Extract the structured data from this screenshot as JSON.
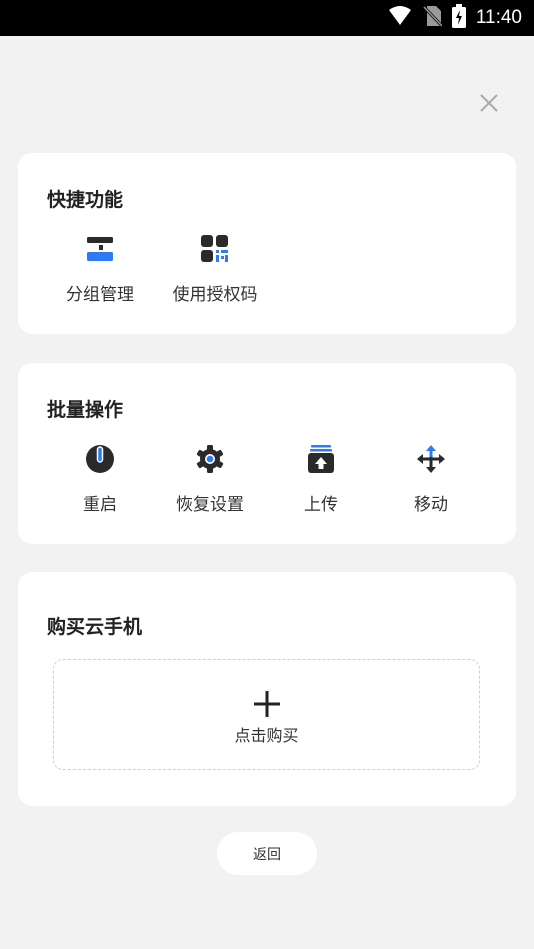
{
  "status_bar": {
    "time": "11:40"
  },
  "quick": {
    "title": "快捷功能",
    "items": [
      {
        "label": "分组管理",
        "icon": "group-manage-icon"
      },
      {
        "label": "使用授权码",
        "icon": "auth-code-icon"
      }
    ]
  },
  "batch": {
    "title": "批量操作",
    "items": [
      {
        "label": "重启",
        "icon": "power-icon"
      },
      {
        "label": "恢复设置",
        "icon": "gear-icon"
      },
      {
        "label": "上传",
        "icon": "upload-icon"
      },
      {
        "label": "移动",
        "icon": "move-icon"
      }
    ]
  },
  "buy": {
    "title": "购买云手机",
    "action_label": "点击购买"
  },
  "back_label": "返回",
  "colors": {
    "accent": "#2f7bf5",
    "icon_dark": "#2a2a2a",
    "background": "#f2f2f2",
    "card": "#ffffff"
  }
}
